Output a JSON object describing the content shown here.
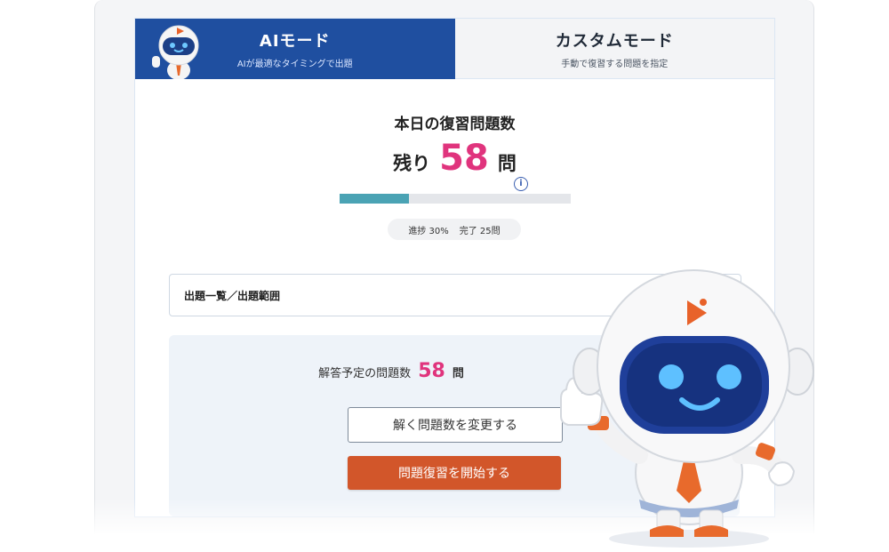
{
  "tabs": {
    "ai": {
      "title": "AIモード",
      "subtitle": "AIが最適なタイミングで出題"
    },
    "custom": {
      "title": "カスタムモード",
      "subtitle": "手動で復習する問題を指定"
    }
  },
  "review": {
    "heading": "本日の復習問題数",
    "remaining_prefix": "残り",
    "remaining_count": "58",
    "remaining_unit": "問",
    "progress_fraction": 0.3,
    "progress_text": "進捗 30%",
    "completed_text": "完了 25問"
  },
  "scope": {
    "label": "出題一覧／出題範囲"
  },
  "plan": {
    "label": "解答予定の問題数",
    "count": "58",
    "unit": "問",
    "change_button": "解く問題数を変更する",
    "start_button": "問題復習を開始する"
  },
  "icons": {
    "info": "info-icon",
    "mascot": "robot-mascot",
    "play_logo": "play-logo-icon"
  },
  "colors": {
    "primary_blue": "#1f4fa0",
    "accent_pink": "#e0347d",
    "progress_teal": "#4aa3b4",
    "start_orange": "#d2562a"
  }
}
